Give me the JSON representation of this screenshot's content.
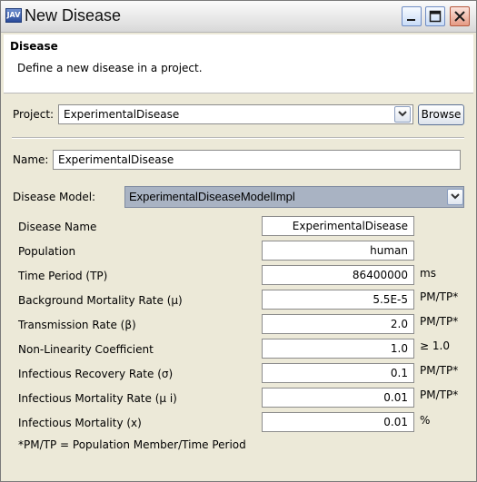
{
  "window": {
    "title": "New Disease",
    "app_icon_text": "JAV"
  },
  "header": {
    "title": "Disease",
    "description": "Define a new disease in a project."
  },
  "project": {
    "label": "Project:",
    "value": "ExperimentalDisease",
    "browse_label": "Browse"
  },
  "name": {
    "label": "Name:",
    "value": "ExperimentalDisease"
  },
  "disease_model": {
    "label": "Disease Model:",
    "value": "ExperimentalDiseaseModelImpl"
  },
  "parameters": [
    {
      "label": "Disease Name",
      "value": "ExperimentalDisease",
      "unit": ""
    },
    {
      "label": "Population",
      "value": "human",
      "unit": ""
    },
    {
      "label": "Time Period (TP)",
      "value": "86400000",
      "unit": "ms"
    },
    {
      "label": "Background Mortality Rate (μ)",
      "value": "5.5E-5",
      "unit": "PM/TP*"
    },
    {
      "label": "Transmission Rate (β)",
      "value": "2.0",
      "unit": "PM/TP*"
    },
    {
      "label": "Non-Linearity Coefficient",
      "value": "1.0",
      "unit": "≥ 1.0"
    },
    {
      "label": "Infectious Recovery Rate (σ)",
      "value": "0.1",
      "unit": "PM/TP*"
    },
    {
      "label": "Infectious Mortality Rate (μ i)",
      "value": "0.01",
      "unit": "PM/TP*"
    },
    {
      "label": "Infectious Mortality (x)",
      "value": "0.01",
      "unit": "%"
    }
  ],
  "footnote": "*PM/TP = Population Member/Time Period"
}
